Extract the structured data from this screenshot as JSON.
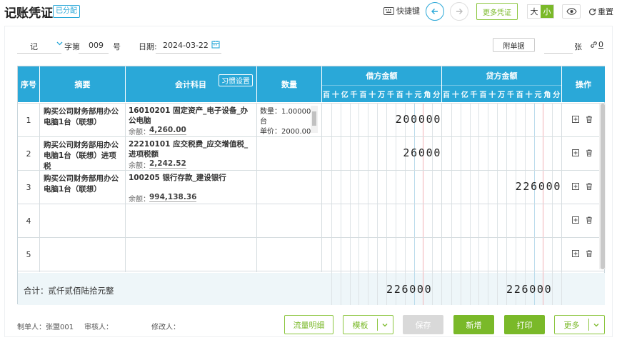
{
  "header": {
    "title": "记账凭证",
    "badge": "已分配",
    "shortcut_label": "快捷键",
    "more_vouchers": "更多凭证",
    "size_large": "大",
    "size_small": "小",
    "reset_label": "重置",
    "prev_icon": "arrow-left-icon",
    "next_icon": "arrow-right-icon",
    "accent_color": "#2aa8d8",
    "brand_green": "#7ab929"
  },
  "form": {
    "voucher_type": "记",
    "zi_label": "字第",
    "number": "009",
    "hao_label": "号",
    "date_label": "日期:",
    "date": "2024-03-22",
    "attach_button": "附单据",
    "attach_count": "",
    "zhang_label": "张",
    "link_count": "0"
  },
  "table": {
    "headers": {
      "seq": "序号",
      "summary": "摘要",
      "account": "会计科目",
      "habit_button": "习惯设置",
      "quantity": "数量",
      "debit": "借方金额",
      "credit": "贷方金额",
      "ops": "操作"
    },
    "digit_units": [
      "百",
      "十",
      "亿",
      "千",
      "百",
      "十",
      "万",
      "千",
      "百",
      "十",
      "元",
      "角",
      "分"
    ],
    "rows": [
      {
        "no": "1",
        "summary": "购买公司财务部用办公电脑1台（联想）",
        "account": "16010201 固定资产_电子设备_办公电脑",
        "balance_label": "余额：",
        "balance": "4,260.00",
        "qty_line1": "数量：1.00000",
        "qty_line2": "台",
        "qty_line3": "单价：2000.00",
        "debit": "200000",
        "credit": ""
      },
      {
        "no": "2",
        "summary": "购买公司财务部用办公电脑1台（联想）进项税",
        "account": "22210101 应交税费_应交增值税_进项税额",
        "balance_label": "余额：",
        "balance": "2,242.52",
        "qty_line1": "",
        "qty_line2": "",
        "qty_line3": "",
        "debit": "26000",
        "credit": ""
      },
      {
        "no": "3",
        "summary": "购买公司财务部用办公电脑1台（联想）",
        "account": "100205 银行存款_建设银行",
        "balance_label": "余额：",
        "balance": "994,138.36",
        "qty_line1": "",
        "qty_line2": "",
        "qty_line3": "",
        "debit": "",
        "credit": "226000"
      },
      {
        "no": "4",
        "summary": "",
        "account": "",
        "balance_label": "",
        "balance": "",
        "qty_line1": "",
        "qty_line2": "",
        "qty_line3": "",
        "debit": "",
        "credit": ""
      },
      {
        "no": "5",
        "summary": "",
        "account": "",
        "balance_label": "",
        "balance": "",
        "qty_line1": "",
        "qty_line2": "",
        "qty_line3": "",
        "debit": "",
        "credit": ""
      }
    ],
    "total_label": "合计：贰仟贰佰陆拾元整",
    "total_debit": "226000",
    "total_credit": "226000"
  },
  "footer": {
    "maker_label": "制单人：张盟001",
    "reviewer_label": "审核人：",
    "modifier_label": "修改人：",
    "flow_detail": "流量明细",
    "template": "模板",
    "save": "保存",
    "add": "新增",
    "print": "打印",
    "more": "更多"
  }
}
